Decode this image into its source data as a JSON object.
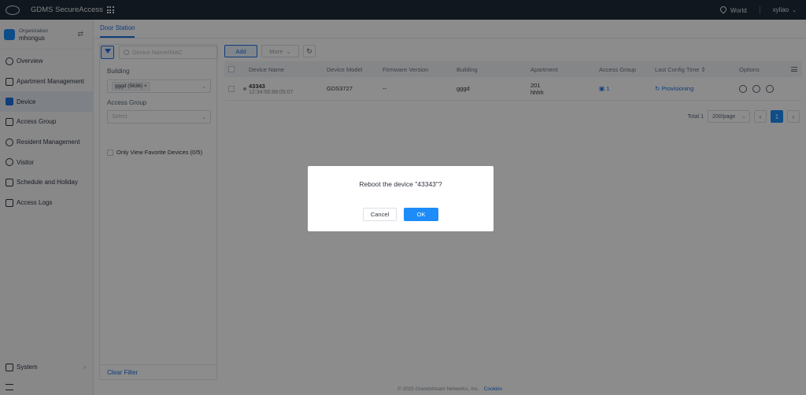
{
  "app": {
    "title": "GDMS SecureAccess",
    "region": "World",
    "user": "xyliao"
  },
  "sidebar": {
    "org_label": "Organization",
    "org_name": "mhongus",
    "items": [
      {
        "label": "Overview",
        "icon": "overview-icon"
      },
      {
        "label": "Apartment Management",
        "icon": "apartment-icon"
      },
      {
        "label": "Device",
        "icon": "device-icon",
        "active": true
      },
      {
        "label": "Access Group",
        "icon": "access-group-icon"
      },
      {
        "label": "Resident Management",
        "icon": "resident-icon"
      },
      {
        "label": "Visitor",
        "icon": "visitor-icon"
      },
      {
        "label": "Schedule and Holiday",
        "icon": "calendar-icon"
      },
      {
        "label": "Access Logs",
        "icon": "logs-icon"
      }
    ],
    "system_label": "System"
  },
  "tabs": {
    "door_station": "Door Station"
  },
  "filters": {
    "search_placeholder": "Device Name/MAC",
    "building_label": "Building",
    "building_tag": "gggd (5636)",
    "access_group_label": "Access Group",
    "access_group_placeholder": "Select",
    "favorite_label": "Only View Favorite Devices (0/5)",
    "clear_filter": "Clear Filter"
  },
  "toolbar": {
    "add": "Add",
    "more": "More"
  },
  "table": {
    "headers": {
      "device_name": "Device Name",
      "device_model": "Device Model",
      "firmware": "Firmware Version",
      "building": "Building",
      "apartment": "Apartment",
      "access_group": "Access Group",
      "last_config": "Last Config Time",
      "options": "Options"
    },
    "rows": [
      {
        "name": "43343",
        "mac": "12:34:56:88:05:07",
        "model": "GDS3727",
        "firmware": "--",
        "building": "gggd",
        "apartment": "201",
        "apartment_sub": "hhhh",
        "access_group": "1",
        "config_status": "Provisioning"
      }
    ]
  },
  "pager": {
    "total": "Total 1",
    "page_size": "200/page",
    "current_page": "1"
  },
  "footer": {
    "copyright": "© 2025 Grandstream Networks, Inc.",
    "cookies": "Cookies"
  },
  "dialog": {
    "message": "Reboot the device \"43343\"?",
    "cancel": "Cancel",
    "ok": "OK"
  },
  "colors": {
    "topbar": "#1f2a37",
    "accent": "#1d8cf8"
  }
}
